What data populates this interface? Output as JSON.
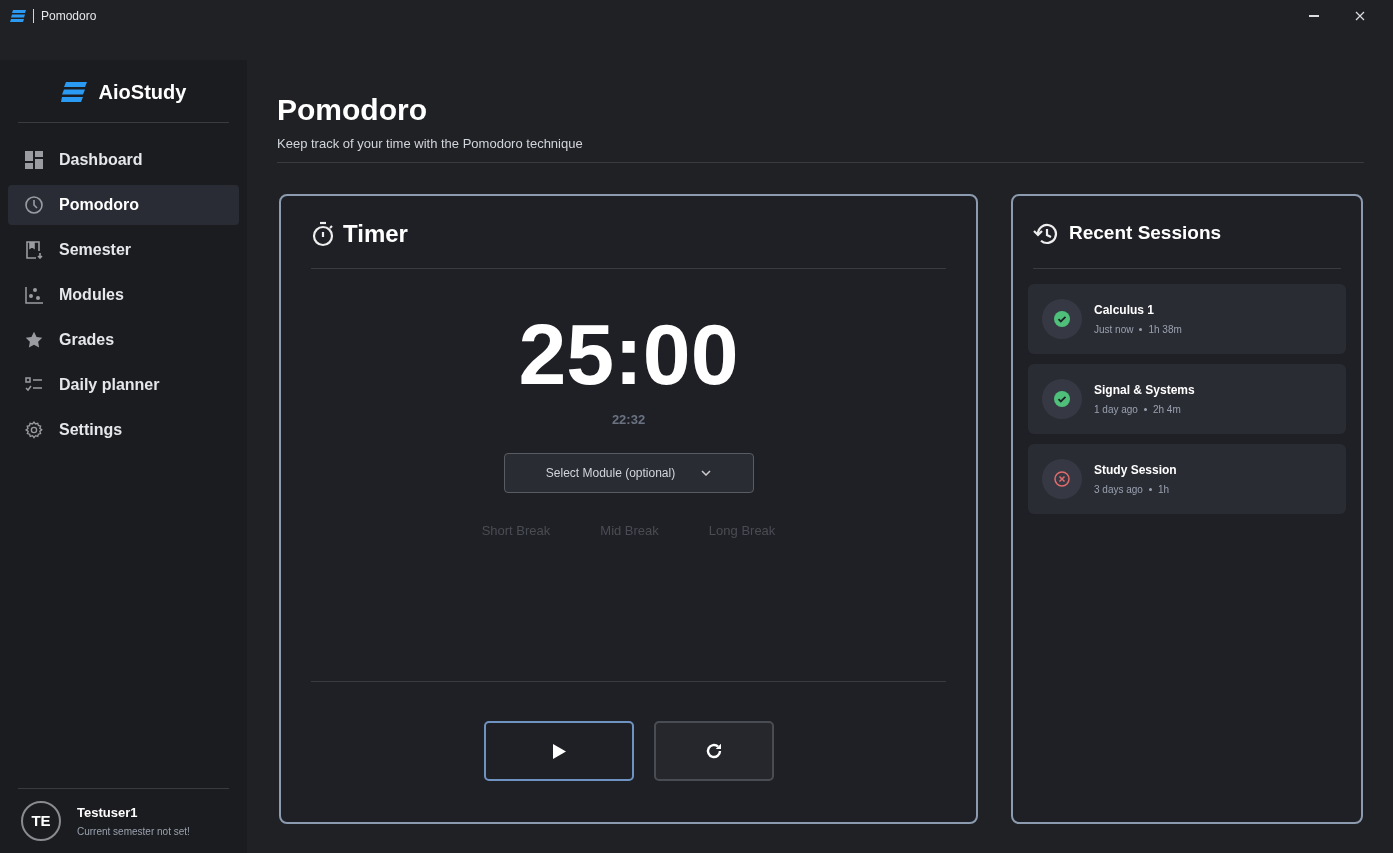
{
  "window": {
    "title": "Pomodoro"
  },
  "sidebar": {
    "brand": "AioStudy",
    "items": [
      {
        "label": "Dashboard",
        "selected": false
      },
      {
        "label": "Pomodoro",
        "selected": true
      },
      {
        "label": "Semester",
        "selected": false
      },
      {
        "label": "Modules",
        "selected": false
      },
      {
        "label": "Grades",
        "selected": false
      },
      {
        "label": "Daily planner",
        "selected": false
      },
      {
        "label": "Settings",
        "selected": false
      }
    ],
    "user": {
      "initials": "TE",
      "name": "Testuser1",
      "subtitle": "Current semester not set!"
    }
  },
  "page": {
    "title": "Pomodoro",
    "subtitle": "Keep track of your time with the Pomodoro technique"
  },
  "timer": {
    "title": "Timer",
    "time": "25:00",
    "end_time": "22:32",
    "module_select": {
      "placeholder": "Select Module (optional)"
    },
    "modes": [
      {
        "label": "Short Break",
        "disabled": true
      },
      {
        "label": "Mid Break",
        "disabled": true
      },
      {
        "label": "Long Break",
        "disabled": true
      }
    ]
  },
  "recent_sessions": {
    "title": "Recent Sessions",
    "items": [
      {
        "name": "Calculus 1",
        "when": "Just now",
        "duration": "1h 38m",
        "kind": "completed"
      },
      {
        "name": "Signal & Systems",
        "when": "1 day ago",
        "duration": "2h 4m",
        "kind": "completed"
      },
      {
        "name": "Study Session",
        "when": "3 days ago",
        "duration": "1h",
        "kind": "cancelled"
      }
    ]
  }
}
